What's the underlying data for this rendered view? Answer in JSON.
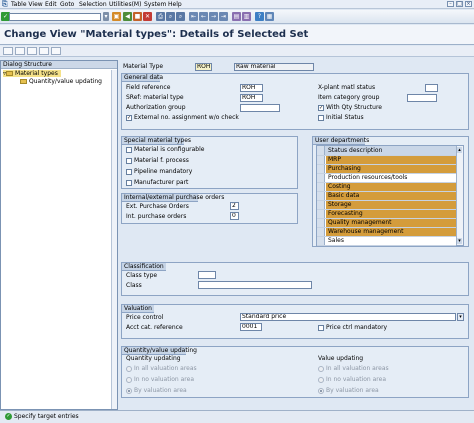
{
  "menu": [
    "Table View",
    "Edit",
    "Goto",
    "Selection",
    "Utilities(M)",
    "System",
    "Help"
  ],
  "title": "Change View \"Material types\": Details of Selected Set",
  "tree": {
    "header": "Dialog Structure",
    "item1": "Material types",
    "item2": "Quantity/value updating"
  },
  "fields": {
    "material_type_label": "Material Type",
    "material_type_value": "ROH",
    "material_type_desc": "Raw material"
  },
  "general": {
    "title": "General data",
    "field_reference_label": "Field reference",
    "field_reference_value": "ROH",
    "sref_label": "SRef: material type",
    "sref_value": "ROH",
    "auth_group_label": "Authorization group",
    "ext_assign_label": "External no. assignment w/o check",
    "xplant_label": "X-plant matl status",
    "item_cat_label": "Item category group",
    "with_qty_label": "With Qty Structure",
    "initial_status_label": "Initial Status"
  },
  "special": {
    "title": "Special material types",
    "items": [
      "Material is configurable",
      "Material f. process",
      "Pipeline mandatory",
      "Manufacturer part"
    ]
  },
  "purchase": {
    "title": "Internal/external purchase orders",
    "ext_label": "Ext. Purchase Orders",
    "ext_value": "2",
    "int_label": "Int. purchase orders",
    "int_value": "0"
  },
  "classification": {
    "title": "Classification",
    "class_type_label": "Class type",
    "class_label": "Class"
  },
  "user_departments": {
    "title": "User departments",
    "header": "Status description",
    "rows": [
      {
        "text": "MRP",
        "hl": true
      },
      {
        "text": "Purchasing",
        "hl": true
      },
      {
        "text": "Production resources/tools",
        "hl": false
      },
      {
        "text": "Costing",
        "hl": true
      },
      {
        "text": "Basic data",
        "hl": true
      },
      {
        "text": "Storage",
        "hl": true
      },
      {
        "text": "Forecasting",
        "hl": true
      },
      {
        "text": "Quality management",
        "hl": true
      },
      {
        "text": "Warehouse management",
        "hl": true
      },
      {
        "text": "Sales",
        "hl": false
      }
    ]
  },
  "valuation": {
    "title": "Valuation",
    "price_control_label": "Price control",
    "price_control_value": "Standard price",
    "acct_label": "Acct cat. reference",
    "acct_value": "0001",
    "price_mandatory_label": "Price ctrl mandatory"
  },
  "qv": {
    "title": "Quantity/value updating",
    "qty_title": "Quantity updating",
    "val_title": "Value updating",
    "opts": [
      "In all valuation areas",
      "In no valuation area",
      "By valuation area"
    ]
  },
  "status": "Specify target entries",
  "colors": {
    "highlight": "#d49c3b",
    "group_header": "#c6d4e6",
    "status_ok": "#2f9a35"
  }
}
